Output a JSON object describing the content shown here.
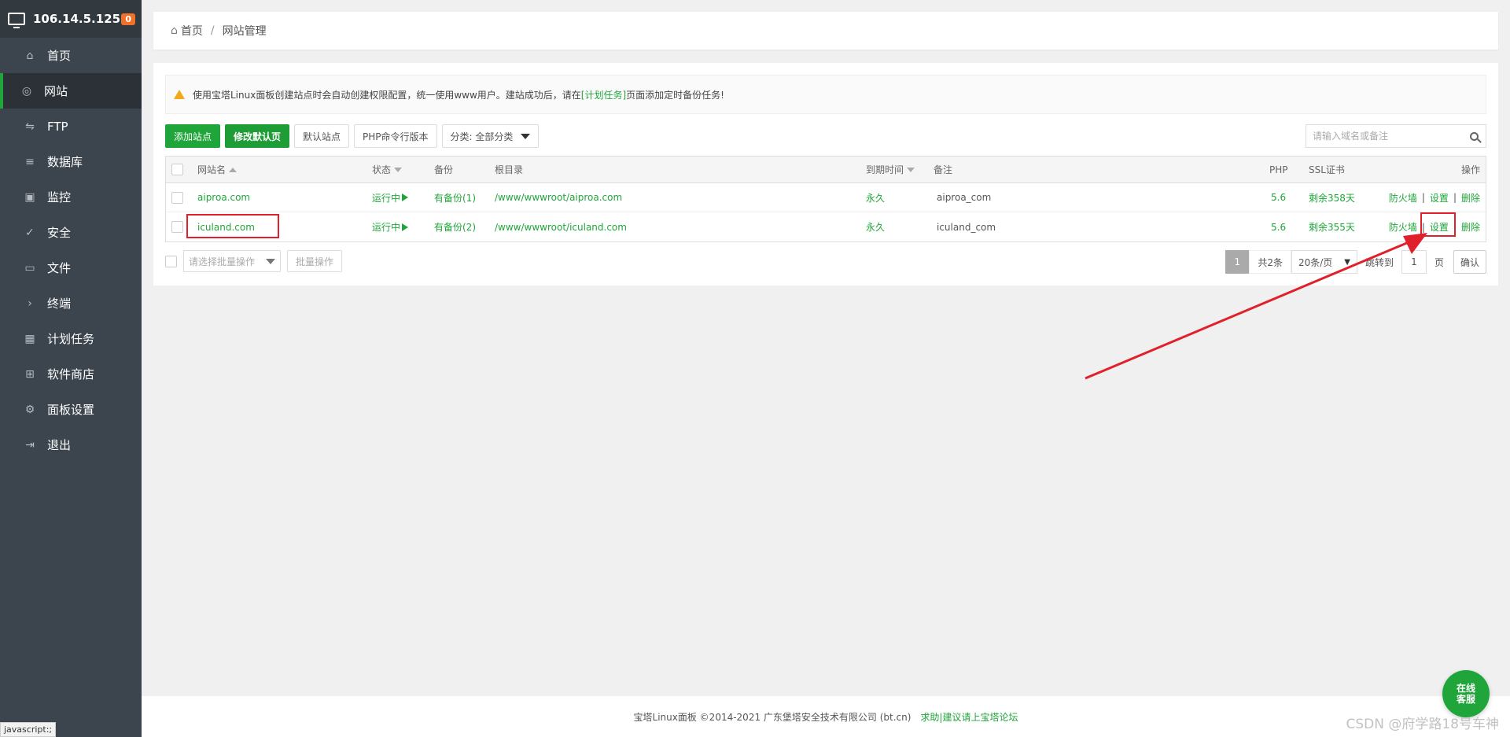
{
  "sidebar": {
    "ip": "106.14.5.125",
    "badge": "0",
    "items": [
      {
        "label": "首页",
        "icon": "home-icon"
      },
      {
        "label": "网站",
        "icon": "globe-icon",
        "active": true
      },
      {
        "label": "FTP",
        "icon": "ftp-icon"
      },
      {
        "label": "数据库",
        "icon": "database-icon"
      },
      {
        "label": "监控",
        "icon": "monitor-icon"
      },
      {
        "label": "安全",
        "icon": "shield-icon"
      },
      {
        "label": "文件",
        "icon": "folder-icon"
      },
      {
        "label": "终端",
        "icon": "terminal-icon"
      },
      {
        "label": "计划任务",
        "icon": "calendar-icon"
      },
      {
        "label": "软件商店",
        "icon": "apps-icon"
      },
      {
        "label": "面板设置",
        "icon": "gear-icon"
      },
      {
        "label": "退出",
        "icon": "logout-icon"
      }
    ]
  },
  "breadcrumb": {
    "home": "首页",
    "sep": "/",
    "current": "网站管理"
  },
  "notice": {
    "before": "使用宝塔Linux面板创建站点时会自动创建权限配置，统一使用www用户。建站成功后，请在",
    "link": "[计划任务]",
    "after": "页面添加定时备份任务!"
  },
  "toolbar": {
    "add_site": "添加站点",
    "modify_default": "修改默认页",
    "default_site": "默认站点",
    "php_cli": "PHP命令行版本",
    "category": "分类: 全部分类"
  },
  "search": {
    "placeholder": "请输入域名或备注"
  },
  "table": {
    "headers": {
      "name": "网站名",
      "status": "状态",
      "backup": "备份",
      "root": "根目录",
      "expire": "到期时间",
      "remark": "备注",
      "php": "PHP",
      "ssl": "SSL证书",
      "ops": "操作"
    },
    "rows": [
      {
        "name": "aiproa.com",
        "status": "运行中",
        "backup": "有备份(1)",
        "root": "/www/wwwroot/aiproa.com",
        "expire": "永久",
        "remark": "aiproa_com",
        "php": "5.6",
        "ssl": "剩余358天",
        "firewall": "防火墙",
        "settings": "设置",
        "delete": "删除"
      },
      {
        "name": "iculand.com",
        "status": "运行中",
        "backup": "有备份(2)",
        "root": "/www/wwwroot/iculand.com",
        "expire": "永久",
        "remark": "iculand_com",
        "php": "5.6",
        "ssl": "剩余355天",
        "firewall": "防火墙",
        "settings": "设置",
        "delete": "删除"
      }
    ],
    "separator": "|"
  },
  "batch": {
    "placeholder": "请选择批量操作",
    "button": "批量操作"
  },
  "pager": {
    "current": "1",
    "total": "共2条",
    "size": "20条/页",
    "jump_label": "跳转到",
    "jump_value": "1",
    "page_unit": "页",
    "confirm": "确认"
  },
  "footer": {
    "copyright": "宝塔Linux面板 ©2014-2021 广东堡塔安全技术有限公司 (bt.cn)",
    "link": "求助|建议请上宝塔论坛"
  },
  "service": {
    "line1": "在线",
    "line2": "客服"
  },
  "watermark": "CSDN @府学路18号车神",
  "status_url": "javascript:;",
  "colors": {
    "accent": "#20a53a",
    "sidebar": "#3c444d",
    "annotation": "#e0212b"
  }
}
